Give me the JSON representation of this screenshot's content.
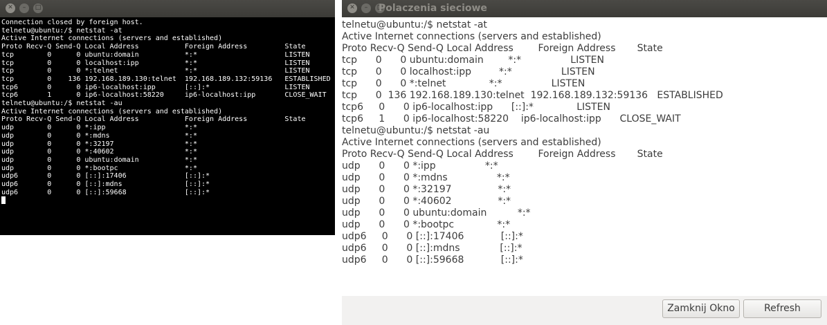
{
  "terminal": {
    "lines": [
      "Connection closed by foreign host.",
      "telnetu@ubuntu:/$ netstat -at",
      "Active Internet connections (servers and established)",
      "Proto Recv-Q Send-Q Local Address           Foreign Address         State",
      "tcp        0      0 ubuntu:domain           *:*                     LISTEN",
      "tcp        0      0 localhost:ipp           *:*                     LISTEN",
      "tcp        0      0 *:telnet                *:*                     LISTEN",
      "tcp        0    136 192.168.189.130:telnet  192.168.189.132:59136   ESTABLISHED",
      "tcp6       0      0 ip6-localhost:ipp       [::]:*                  LISTEN",
      "tcp6       1      0 ip6-localhost:58220     ip6-localhost:ipp       CLOSE_WAIT",
      "telnetu@ubuntu:/$ netstat -au",
      "Active Internet connections (servers and established)",
      "Proto Recv-Q Send-Q Local Address           Foreign Address         State",
      "udp        0      0 *:ipp                   *:*",
      "udp        0      0 *:mdns                  *:*",
      "udp        0      0 *:32197                 *:*",
      "udp        0      0 *:40602                 *:*",
      "udp        0      0 ubuntu:domain           *:*",
      "udp        0      0 *:bootpc                *:*",
      "udp6       0      0 [::]:17406              [::]:*",
      "udp6       0      0 [::]:mdns               [::]:*",
      "udp6       0      0 [::]:59668              [::]:*",
      ""
    ]
  },
  "gui": {
    "title": "Polaczenia sieciowe",
    "lines": [
      "telnetu@ubuntu:/$ netstat -at",
      "Active Internet connections (servers and established)",
      "Proto Recv-Q Send-Q Local Address        Foreign Address       State",
      "tcp      0      0 ubuntu:domain        *:*                LISTEN",
      "tcp      0      0 localhost:ipp         *:*                LISTEN",
      "tcp      0      0 *:telnet              *:*                LISTEN",
      "tcp      0  136 192.168.189.130:telnet  192.168.189.132:59136   ESTABLISHED",
      "tcp6     0      0 ip6-localhost:ipp      [::]:*              LISTEN",
      "tcp6     1      0 ip6-localhost:58220    ip6-localhost:ipp      CLOSE_WAIT",
      "telnetu@ubuntu:/$ netstat -au",
      "Active Internet connections (servers and established)",
      "Proto Recv-Q Send-Q Local Address        Foreign Address       State",
      "udp      0      0 *:ipp                *:*",
      "udp      0      0 *:mdns                *:*",
      "udp      0      0 *:32197               *:*",
      "udp      0      0 *:40602               *:*",
      "udp      0      0 ubuntu:domain          *:*",
      "udp      0      0 *:bootpc              *:*",
      "udp6     0      0 [::]:17406            [::]:*",
      "udp6     0      0 [::]:mdns             [::]:*",
      "udp6     0      0 [::]:59668            [::]:*"
    ],
    "buttons": {
      "close": "Zamknij Okno",
      "refresh": "Refresh"
    }
  },
  "icons": {
    "close": "close-icon",
    "minimize": "minimize-icon",
    "maximize": "maximize-icon"
  },
  "colors": {
    "titlebar": "#3c3b37",
    "terminal_bg": "#000000",
    "terminal_fg": "#ffffff",
    "gui_bg": "#f2f1f0"
  }
}
